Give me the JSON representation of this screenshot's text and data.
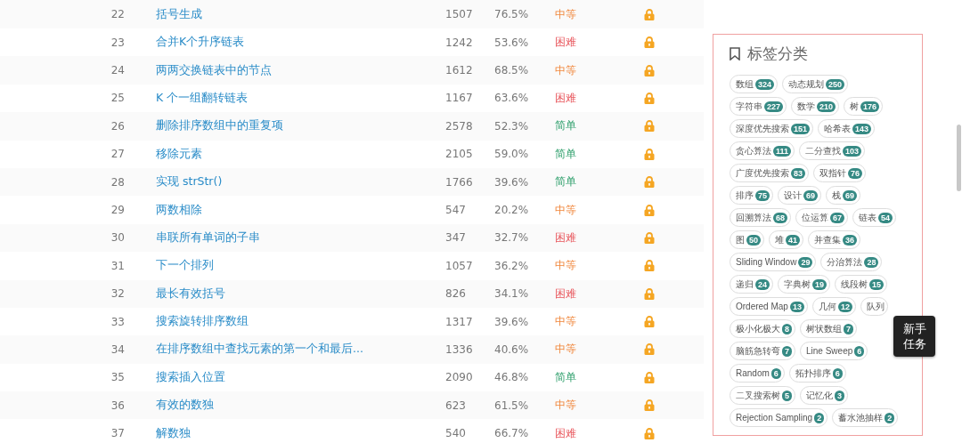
{
  "problems": [
    {
      "number": "22",
      "title": "括号生成",
      "count": "1507",
      "rate": "76.5%",
      "difficulty": "中等",
      "kind": "medium",
      "locked": true
    },
    {
      "number": "23",
      "title": "合并K个升序链表",
      "count": "1242",
      "rate": "53.6%",
      "difficulty": "困难",
      "kind": "hard",
      "locked": true
    },
    {
      "number": "24",
      "title": "两两交换链表中的节点",
      "count": "1612",
      "rate": "68.5%",
      "difficulty": "中等",
      "kind": "medium",
      "locked": true
    },
    {
      "number": "25",
      "title": "K 个一组翻转链表",
      "count": "1167",
      "rate": "63.6%",
      "difficulty": "困难",
      "kind": "hard",
      "locked": true
    },
    {
      "number": "26",
      "title": "删除排序数组中的重复项",
      "count": "2578",
      "rate": "52.3%",
      "difficulty": "简单",
      "kind": "easy",
      "locked": true
    },
    {
      "number": "27",
      "title": "移除元素",
      "count": "2105",
      "rate": "59.0%",
      "difficulty": "简单",
      "kind": "easy",
      "locked": true
    },
    {
      "number": "28",
      "title": "实现 strStr()",
      "count": "1766",
      "rate": "39.6%",
      "difficulty": "简单",
      "kind": "easy",
      "locked": true
    },
    {
      "number": "29",
      "title": "两数相除",
      "count": "547",
      "rate": "20.2%",
      "difficulty": "中等",
      "kind": "medium",
      "locked": true
    },
    {
      "number": "30",
      "title": "串联所有单词的子串",
      "count": "347",
      "rate": "32.7%",
      "difficulty": "困难",
      "kind": "hard",
      "locked": true
    },
    {
      "number": "31",
      "title": "下一个排列",
      "count": "1057",
      "rate": "36.2%",
      "difficulty": "中等",
      "kind": "medium",
      "locked": true
    },
    {
      "number": "32",
      "title": "最长有效括号",
      "count": "826",
      "rate": "34.1%",
      "difficulty": "困难",
      "kind": "hard",
      "locked": true
    },
    {
      "number": "33",
      "title": "搜索旋转排序数组",
      "count": "1317",
      "rate": "39.6%",
      "difficulty": "中等",
      "kind": "medium",
      "locked": true
    },
    {
      "number": "34",
      "title": "在排序数组中查找元素的第一个和最后...",
      "count": "1336",
      "rate": "40.6%",
      "difficulty": "中等",
      "kind": "medium",
      "locked": true
    },
    {
      "number": "35",
      "title": "搜索插入位置",
      "count": "2090",
      "rate": "46.8%",
      "difficulty": "简单",
      "kind": "easy",
      "locked": true
    },
    {
      "number": "36",
      "title": "有效的数独",
      "count": "623",
      "rate": "61.5%",
      "difficulty": "中等",
      "kind": "medium",
      "locked": true
    },
    {
      "number": "37",
      "title": "解数独",
      "count": "540",
      "rate": "66.7%",
      "difficulty": "困难",
      "kind": "hard",
      "locked": true
    }
  ],
  "tag_panel": {
    "title": "标签分类",
    "tag_rows": [
      [
        {
          "name": "数组",
          "count": "324"
        },
        {
          "name": "动态规划",
          "count": "250"
        }
      ],
      [
        {
          "name": "字符串",
          "count": "227"
        },
        {
          "name": "数学",
          "count": "210"
        },
        {
          "name": "树",
          "count": "176"
        }
      ],
      [
        {
          "name": "深度优先搜索",
          "count": "151"
        },
        {
          "name": "哈希表",
          "count": "143"
        }
      ],
      [
        {
          "name": "贪心算法",
          "count": "111"
        },
        {
          "name": "二分查找",
          "count": "103"
        }
      ],
      [
        {
          "name": "广度优先搜索",
          "count": "83"
        },
        {
          "name": "双指针",
          "count": "76"
        }
      ],
      [
        {
          "name": "排序",
          "count": "75"
        },
        {
          "name": "设计",
          "count": "69"
        },
        {
          "name": "栈",
          "count": "69"
        }
      ],
      [
        {
          "name": "回溯算法",
          "count": "68"
        },
        {
          "name": "位运算",
          "count": "67"
        },
        {
          "name": "链表",
          "count": "54"
        }
      ],
      [
        {
          "name": "图",
          "count": "50"
        },
        {
          "name": "堆",
          "count": "41"
        },
        {
          "name": "并查集",
          "count": "36"
        }
      ],
      [
        {
          "name": "Sliding Window",
          "count": "29"
        },
        {
          "name": "分治算法",
          "count": "28"
        }
      ],
      [
        {
          "name": "递归",
          "count": "24"
        },
        {
          "name": "字典树",
          "count": "19"
        },
        {
          "name": "线段树",
          "count": "15"
        }
      ],
      [
        {
          "name": "Ordered Map",
          "count": "13"
        },
        {
          "name": "几何",
          "count": "12"
        },
        {
          "name": "队列"
        }
      ],
      [
        {
          "name": "极小化极大",
          "count": "8"
        },
        {
          "name": "树状数组",
          "count": "7"
        }
      ],
      [
        {
          "name": "脑筋急转弯",
          "count": "7"
        },
        {
          "name": "Line Sweep",
          "count": "6"
        }
      ],
      [
        {
          "name": "Random",
          "count": "6"
        },
        {
          "name": "拓扑排序",
          "count": "6"
        }
      ],
      [
        {
          "name": "二叉搜索树",
          "count": "5"
        },
        {
          "name": "记忆化",
          "count": "3"
        }
      ],
      [
        {
          "name": "Rejection Sampling",
          "count": "2"
        },
        {
          "name": "蓄水池抽样",
          "count": "2"
        }
      ]
    ]
  },
  "floating_button": {
    "label": "新手任务"
  }
}
